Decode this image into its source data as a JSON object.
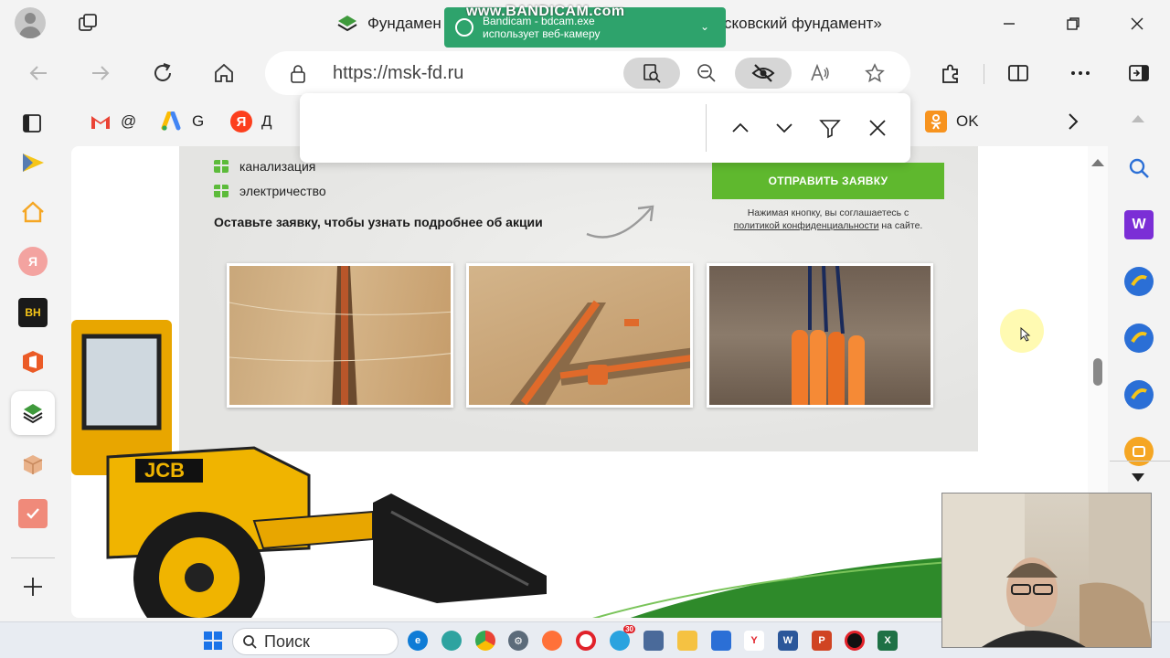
{
  "window": {
    "title_left": "Фундамен",
    "title_right": "«Московский фундамент»",
    "minimize": "—",
    "restore": "❐",
    "close": "✕"
  },
  "bandicam": {
    "watermark": "www.BANDICAM.com",
    "app": "Bandicam - bdcam.exe",
    "message": "использует веб-камеру"
  },
  "address_bar": {
    "url": "https://msk-fd.ru"
  },
  "favorites": [
    {
      "label": "@",
      "icon": "gmail-icon"
    },
    {
      "label": "G",
      "icon": "google-ads-icon"
    },
    {
      "label": "Д",
      "icon": "yandex-icon"
    },
    {
      "label": "OK",
      "icon": "odnoklassniki-icon"
    }
  ],
  "page": {
    "features": [
      "канализация",
      "электричество"
    ],
    "cta": "Оставьте заявку, чтобы узнать подробнее об акции",
    "submit_button": "ОТПРАВИТЬ ЗАЯВКУ",
    "consent_prefix": "Нажимая кнопку, вы соглашаетесь с",
    "consent_link": "политикой конфиденциальности",
    "consent_suffix": "на сайте."
  },
  "left_sidebar": {
    "bh_label": "BH",
    "ya_label": "Я"
  },
  "right_sidebar": {
    "w_label": "W"
  },
  "taskbar": {
    "search_placeholder": "Поиск",
    "telegram_badge": "30"
  },
  "colors": {
    "accent_green": "#5fb82e",
    "browser_bg": "#f3f3f3",
    "bandicam_green": "#2ea36c"
  }
}
